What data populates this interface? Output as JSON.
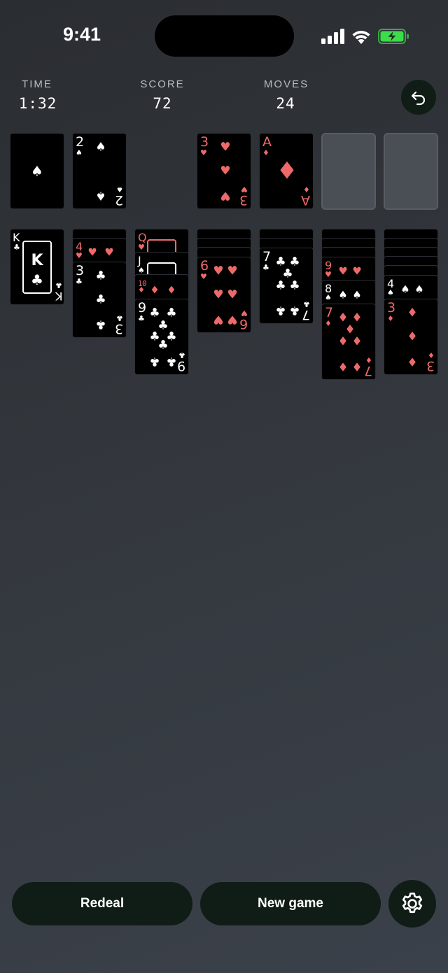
{
  "status_bar": {
    "time": "9:41"
  },
  "stats": [
    {
      "label": "TIME",
      "value": "1:32"
    },
    {
      "label": "SCORE",
      "value": "72"
    },
    {
      "label": "MOVES",
      "value": "24"
    }
  ],
  "foundation_top": {
    "stock_suit": "♠",
    "waste_rank": "2",
    "waste_suit": "♠",
    "found1_rank": "3",
    "found1_suit": "♥",
    "found2_rank": "A",
    "found2_suit": "♦"
  },
  "tableau": {
    "c1_rank": "K",
    "c1_suit": "♣",
    "c1_center": "K",
    "c2_under_rank": "4",
    "c2_under_suit": "♥",
    "c2_rank": "3",
    "c2_suit": "♣",
    "c3_q_rank": "Q",
    "c3_q_suit": "♥",
    "c3_j_rank": "J",
    "c3_j_suit": "♠",
    "c3_10_rank": "10",
    "c3_10_suit": "♦",
    "c3_rank": "9",
    "c3_suit": "♣",
    "c4_rank": "6",
    "c4_suit": "♥",
    "c5_rank": "7",
    "c5_suit": "♣",
    "c6_a_rank": "9",
    "c6_a_suit": "♥",
    "c6_b_rank": "8",
    "c6_b_suit": "♠",
    "c6_rank": "7",
    "c6_suit": "♦",
    "c7_a_rank": "4",
    "c7_a_suit": "♠",
    "c7_rank": "3",
    "c7_suit": "♦"
  },
  "buttons": {
    "redeal": "Redeal",
    "new_game": "New game"
  },
  "icons": {
    "undo": "undo-icon",
    "settings": "gear-icon"
  },
  "colors": {
    "red_suit": "#ee6a6a",
    "black_suit": "#ffffff",
    "button_bg": "#101c16",
    "battery_green": "#3ddc4a"
  }
}
